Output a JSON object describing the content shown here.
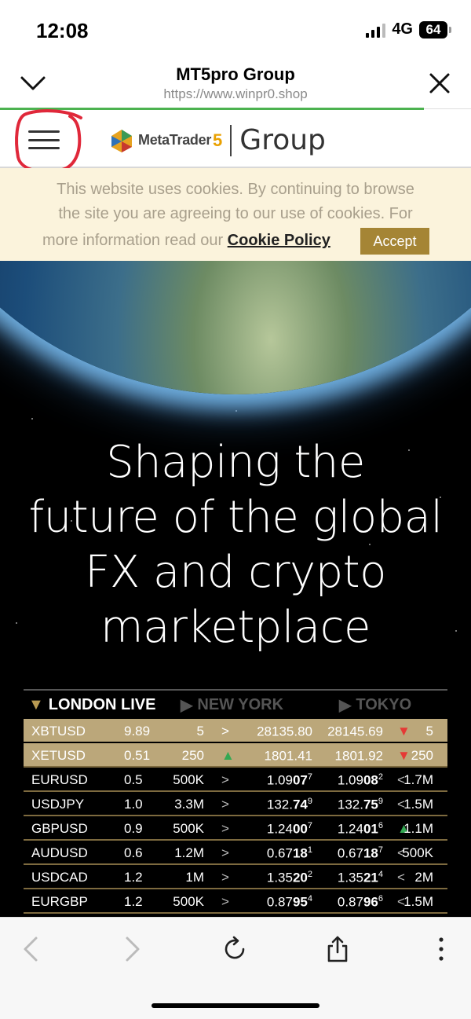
{
  "status": {
    "time": "12:08",
    "network": "4G",
    "battery": "64"
  },
  "browser": {
    "title": "MT5pro Group",
    "url": "https://www.winpr0.shop"
  },
  "site": {
    "logo_text": "MetaTrader",
    "logo_number": "5",
    "logo_group": "Group"
  },
  "cookie": {
    "line1": "This website uses cookies. By continuing to browse",
    "line2": "the site you are agreeing to our use of cookies. For",
    "line3_prefix": "more information read our ",
    "link": "Cookie Policy",
    "accept": "Accept"
  },
  "hero": {
    "line1": "Shaping the",
    "line2": "future of the global",
    "line3": "FX and crypto",
    "line4": "marketplace"
  },
  "ticker": {
    "tabs": {
      "london": "LONDON LIVE",
      "newyork": "NEW YORK",
      "tokyo": "TOKYO"
    },
    "rows": [
      {
        "symbol": "XBTUSD",
        "spread": "9.89",
        "vol1": "5",
        "dir1": ">",
        "bid_a": "28135.80",
        "bid_b": "",
        "bid_c": "",
        "ask_a": "28145.69",
        "ask_b": "",
        "ask_c": "",
        "dir2": "▼",
        "vol2": "5"
      },
      {
        "symbol": "XETUSD",
        "spread": "0.51",
        "vol1": "250",
        "dir1": "▲",
        "bid_a": "1801.41",
        "bid_b": "",
        "bid_c": "",
        "ask_a": "1801.92",
        "ask_b": "",
        "ask_c": "",
        "dir2": "▼",
        "vol2": "250"
      },
      {
        "symbol": "EURUSD",
        "spread": "0.5",
        "vol1": "500K",
        "dir1": ">",
        "bid_a": "1.09",
        "bid_b": "07",
        "bid_c": "7",
        "ask_a": "1.09",
        "ask_b": "08",
        "ask_c": "2",
        "dir2": "<",
        "vol2": "1.7M"
      },
      {
        "symbol": "USDJPY",
        "spread": "1.0",
        "vol1": "3.3M",
        "dir1": ">",
        "bid_a": "132.",
        "bid_b": "74",
        "bid_c": "9",
        "ask_a": "132.",
        "ask_b": "75",
        "ask_c": "9",
        "dir2": "<",
        "vol2": "1.5M"
      },
      {
        "symbol": "GBPUSD",
        "spread": "0.9",
        "vol1": "500K",
        "dir1": ">",
        "bid_a": "1.24",
        "bid_b": "00",
        "bid_c": "7",
        "ask_a": "1.24",
        "ask_b": "01",
        "ask_c": "6",
        "dir2": "▲",
        "vol2": "1.1M"
      },
      {
        "symbol": "AUDUSD",
        "spread": "0.6",
        "vol1": "1.2M",
        "dir1": ">",
        "bid_a": "0.67",
        "bid_b": "18",
        "bid_c": "1",
        "ask_a": "0.67",
        "ask_b": "18",
        "ask_c": "7",
        "dir2": "<",
        "vol2": "500K"
      },
      {
        "symbol": "USDCAD",
        "spread": "1.2",
        "vol1": "1M",
        "dir1": ">",
        "bid_a": "1.35",
        "bid_b": "20",
        "bid_c": "2",
        "ask_a": "1.35",
        "ask_b": "21",
        "ask_c": "4",
        "dir2": "<",
        "vol2": "2M"
      },
      {
        "symbol": "EURGBP",
        "spread": "1.2",
        "vol1": "500K",
        "dir1": ">",
        "bid_a": "0.87",
        "bid_b": "95",
        "bid_c": "4",
        "ask_a": "0.87",
        "ask_b": "96",
        "ask_c": "6",
        "dir2": "<",
        "vol2": "1.5M"
      }
    ]
  },
  "colors": {
    "accent": "#a58535",
    "ticker_highlight": "#bba77a",
    "cookie_bg": "#fbf3dc",
    "annotation": "#e0283a"
  },
  "icons": [
    "chevron-down-icon",
    "close-icon",
    "hamburger-icon",
    "metatrader-logo-icon",
    "back-icon",
    "forward-icon",
    "reload-icon",
    "share-icon",
    "more-icon"
  ]
}
